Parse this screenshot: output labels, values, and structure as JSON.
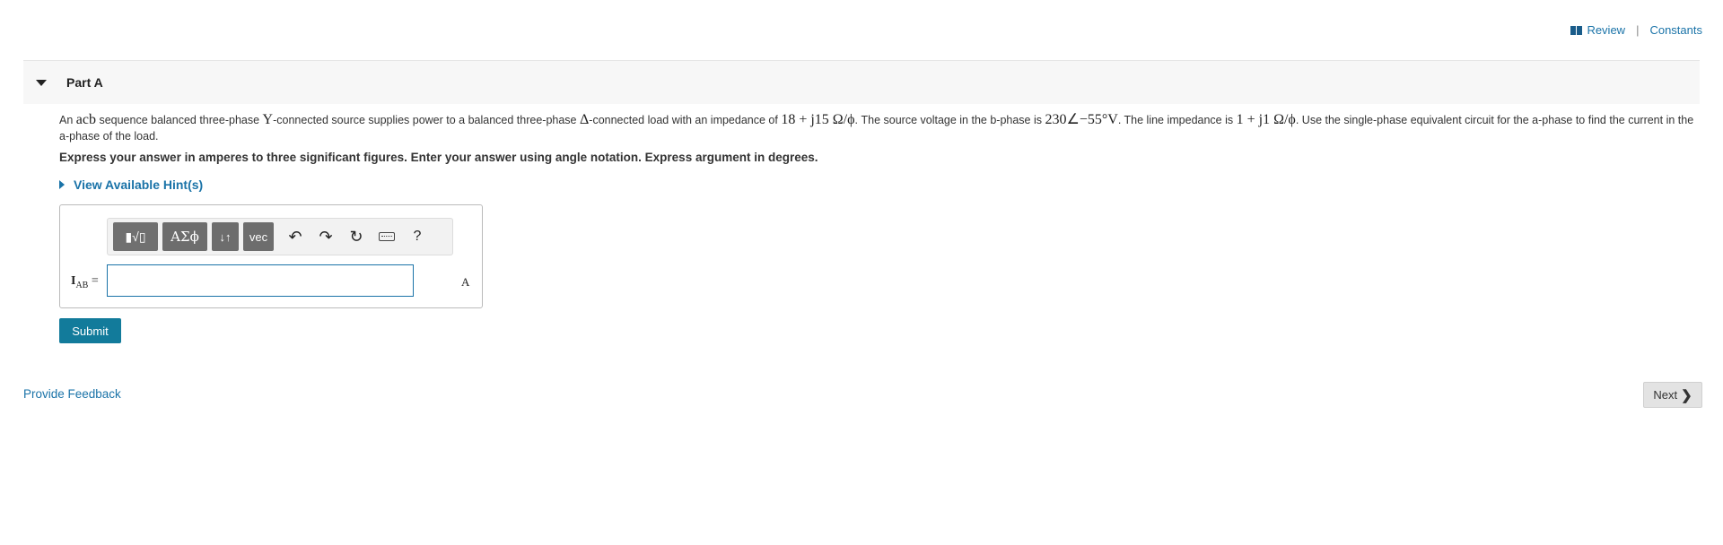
{
  "topnav": {
    "review": "Review",
    "separator": "|",
    "constants": "Constants"
  },
  "part": {
    "title": "Part A"
  },
  "question": {
    "t1": "An ",
    "sequence": "acb",
    "t2": " sequence balanced three-phase ",
    "source_conn": "Y",
    "t3": "-connected source supplies power to a balanced three-phase ",
    "load_conn": "Δ",
    "t4": "-connected load with an impedance of ",
    "load_impedance": "18 + j15 Ω/ϕ",
    "t5": ". The source voltage in the b-phase is ",
    "source_voltage": "230∠−55°V",
    "t6": ". The line impedance is ",
    "line_impedance": "1 + j1 Ω/ϕ",
    "t7": ". Use the single-phase equivalent circuit for the a-phase to find the current in the a-phase of the load."
  },
  "instruction": "Express your answer in amperes to three significant figures. Enter your answer using angle notation. Express argument in degrees.",
  "hint": "View Available Hint(s)",
  "toolbar": {
    "templates": "▮√▯",
    "symbols": "ΑΣϕ",
    "arrows": "↓↑",
    "vec": "vec",
    "undo": "↶",
    "redo": "↷",
    "reset": "↻",
    "help": "?"
  },
  "answer": {
    "var_main": "I",
    "var_sub": "AB",
    "equals": "=",
    "value": "",
    "unit": "A"
  },
  "submit": "Submit",
  "feedback": "Provide Feedback",
  "next": "Next",
  "next_chevron": "❯",
  "icons": [
    "book-icon",
    "caret-down-icon",
    "caret-right-icon",
    "undo-icon",
    "redo-icon",
    "reset-icon",
    "keyboard-icon",
    "help-icon",
    "chevron-right-icon"
  ]
}
